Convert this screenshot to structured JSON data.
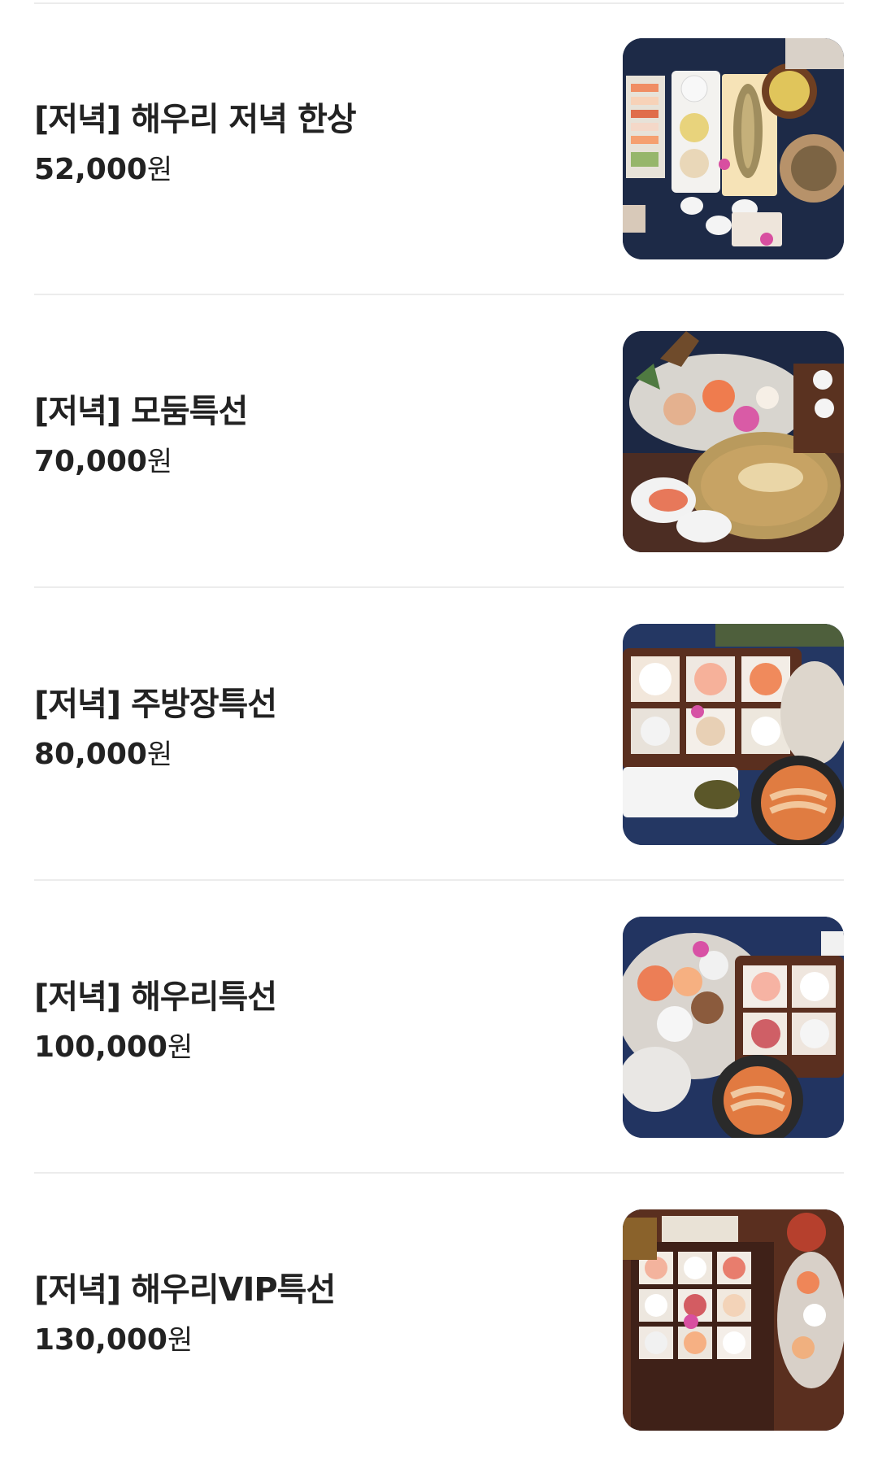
{
  "menu": {
    "items": [
      {
        "name": "[저녁] 해우리 저녁 한상",
        "price_number": "52,000",
        "price_unit": "원",
        "image": "dinner-set-food-photo"
      },
      {
        "name": "[저녁] 모둠특선",
        "price_number": "70,000",
        "price_unit": "원",
        "image": "assorted-special-food-photo"
      },
      {
        "name": "[저녁] 주방장특선",
        "price_number": "80,000",
        "price_unit": "원",
        "image": "chef-special-food-photo"
      },
      {
        "name": "[저녁] 해우리특선",
        "price_number": "100,000",
        "price_unit": "원",
        "image": "haeuri-special-food-photo"
      },
      {
        "name": "[저녁] 해우리VIP특선",
        "price_number": "130,000",
        "price_unit": "원",
        "image": "haeuri-vip-special-food-photo"
      }
    ]
  },
  "colors": {
    "text": "#222222",
    "divider": "#ececec",
    "table_navy": "#1d2a47",
    "wood": "#5a2f1f"
  }
}
